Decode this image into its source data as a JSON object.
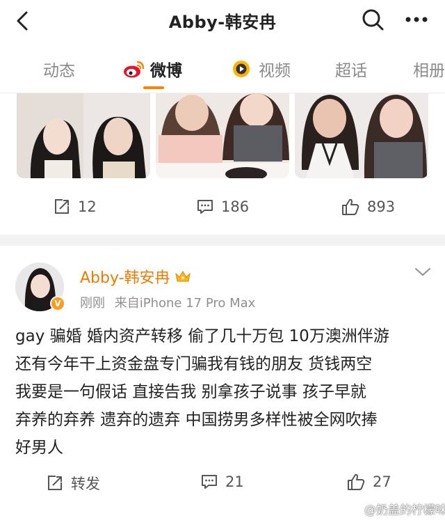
{
  "header": {
    "title": "Abby-韩安冉",
    "back_icon": "back-arrow-icon",
    "search_icon": "search-icon",
    "more_icon": "more-dots-icon"
  },
  "tabs": [
    {
      "label": "动态",
      "active": false
    },
    {
      "label": "微博",
      "active": true,
      "icon": "weibo-logo-icon"
    },
    {
      "label": "视频",
      "active": false,
      "icon": "video-play-icon"
    },
    {
      "label": "超话",
      "active": false
    },
    {
      "label": "相册",
      "active": false
    }
  ],
  "post1": {
    "photos": [
      "before-after-photo-1",
      "before-after-photo-2",
      "before-after-photo-3"
    ],
    "repost_count": "12",
    "comment_count": "186",
    "like_count": "893"
  },
  "post2": {
    "author": "Abby-韩安冉",
    "author_badge_icon": "crown-icon",
    "time": "刚刚",
    "source": "来自iPhone 17 Pro Max",
    "text_lines": [
      "gay 骗婚  婚内资产转移  偷了几十万包  10万澳洲伴游",
      "还有今年干上资金盘专门骗我有钱的朋友  货钱两空",
      "我要是一句假话  直接告我   别拿孩子说事  孩子早就",
      "弃养的弃养  遗弃的遗弃  中国捞男多样性被全网吹捧",
      "好男人"
    ],
    "repost_label": "转发",
    "comment_count": "21",
    "like_count": "27"
  },
  "watermark": "@奶盖的柠檬味",
  "colors": {
    "accent": "#ff8200",
    "author_name": "#f07a00",
    "separator": "#f2f2f2"
  }
}
